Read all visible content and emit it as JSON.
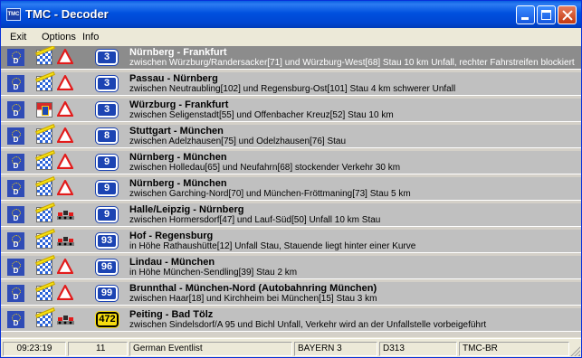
{
  "window": {
    "app_icon_text": "TMC",
    "title": "TMC - Decoder"
  },
  "menu": [
    "Exit",
    "Options",
    "Info"
  ],
  "messages": [
    {
      "country": "D",
      "flag": "bavaria",
      "sign": "warning",
      "road": "3",
      "road_type": "autobahn",
      "route": "Nürnberg - Frankfurt",
      "detail": "zwischen Würzburg/Randersacker[71] und Würzburg-West[68] Stau 10 km Unfall, rechter Fahrstreifen blockiert",
      "selected": true
    },
    {
      "country": "D",
      "flag": "bavaria",
      "sign": "warning",
      "road": "3",
      "road_type": "autobahn",
      "route": "Passau - Nürnberg",
      "detail": "zwischen Neutraubling[102] und Regensburg-Ost[101] Stau 4 km schwerer Unfall"
    },
    {
      "country": "D",
      "flag": "hesse",
      "sign": "warning",
      "road": "3",
      "road_type": "autobahn",
      "route": "Würzburg - Frankfurt",
      "detail": "zwischen Seligenstadt[55] und Offenbacher Kreuz[52] Stau 10 km"
    },
    {
      "country": "D",
      "flag": "bavaria",
      "sign": "warning",
      "road": "8",
      "road_type": "autobahn",
      "route": "Stuttgart - München",
      "detail": "zwischen Adelzhausen[75] und Odelzhausen[76] Stau"
    },
    {
      "country": "D",
      "flag": "bavaria",
      "sign": "warning",
      "road": "9",
      "road_type": "autobahn",
      "route": "Nürnberg - München",
      "detail": "zwischen Holledau[65] und Neufahrn[68] stockender Verkehr 30 km"
    },
    {
      "country": "D",
      "flag": "bavaria",
      "sign": "warning",
      "road": "9",
      "road_type": "autobahn",
      "route": "Nürnberg - München",
      "detail": "zwischen Garching-Nord[70] und München-Fröttmaning[73] Stau 5 km"
    },
    {
      "country": "D",
      "flag": "bavaria",
      "sign": "jam",
      "road": "9",
      "road_type": "autobahn",
      "route": "Halle/Leipzig - Nürnberg",
      "detail": "zwischen Hormersdorf[47] und Lauf-Süd[50] Unfall 10 km Stau"
    },
    {
      "country": "D",
      "flag": "bavaria",
      "sign": "jam",
      "road": "93",
      "road_type": "autobahn",
      "route": "Hof - Regensburg",
      "detail": "in Höhe Rathaushütte[12] Unfall Stau, Stauende liegt hinter einer Kurve"
    },
    {
      "country": "D",
      "flag": "bavaria",
      "sign": "warning",
      "road": "96",
      "road_type": "autobahn",
      "route": "Lindau - München",
      "detail": "in Höhe München-Sendling[39] Stau 2 km"
    },
    {
      "country": "D",
      "flag": "bavaria",
      "sign": "warning",
      "road": "99",
      "road_type": "autobahn",
      "route": "Brunnthal - München-Nord (Autobahnring München)",
      "detail": "zwischen Haar[18] und Kirchheim bei München[15] Stau 3 km"
    },
    {
      "country": "D",
      "flag": "bavaria",
      "sign": "jam",
      "road": "472",
      "road_type": "federal",
      "route": "Peiting - Bad Tölz",
      "detail": "zwischen Sindelsdorf/A 95 und Bichl Unfall, Verkehr wird an der Unfallstelle vorbeigeführt"
    }
  ],
  "status": {
    "time": "09:23:19",
    "count": "11",
    "list_name": "German Eventlist",
    "station": "BAYERN 3",
    "pi_code": "D313",
    "provider": "TMC-BR"
  },
  "colors": {
    "titlebar": "#0050de",
    "selected_row": "#8c8c8c",
    "row": "#c0c0c0",
    "autobahn_badge": "#1c44b3",
    "federal_badge": "#f6dc0c",
    "warning_red": "#e21b1b"
  }
}
